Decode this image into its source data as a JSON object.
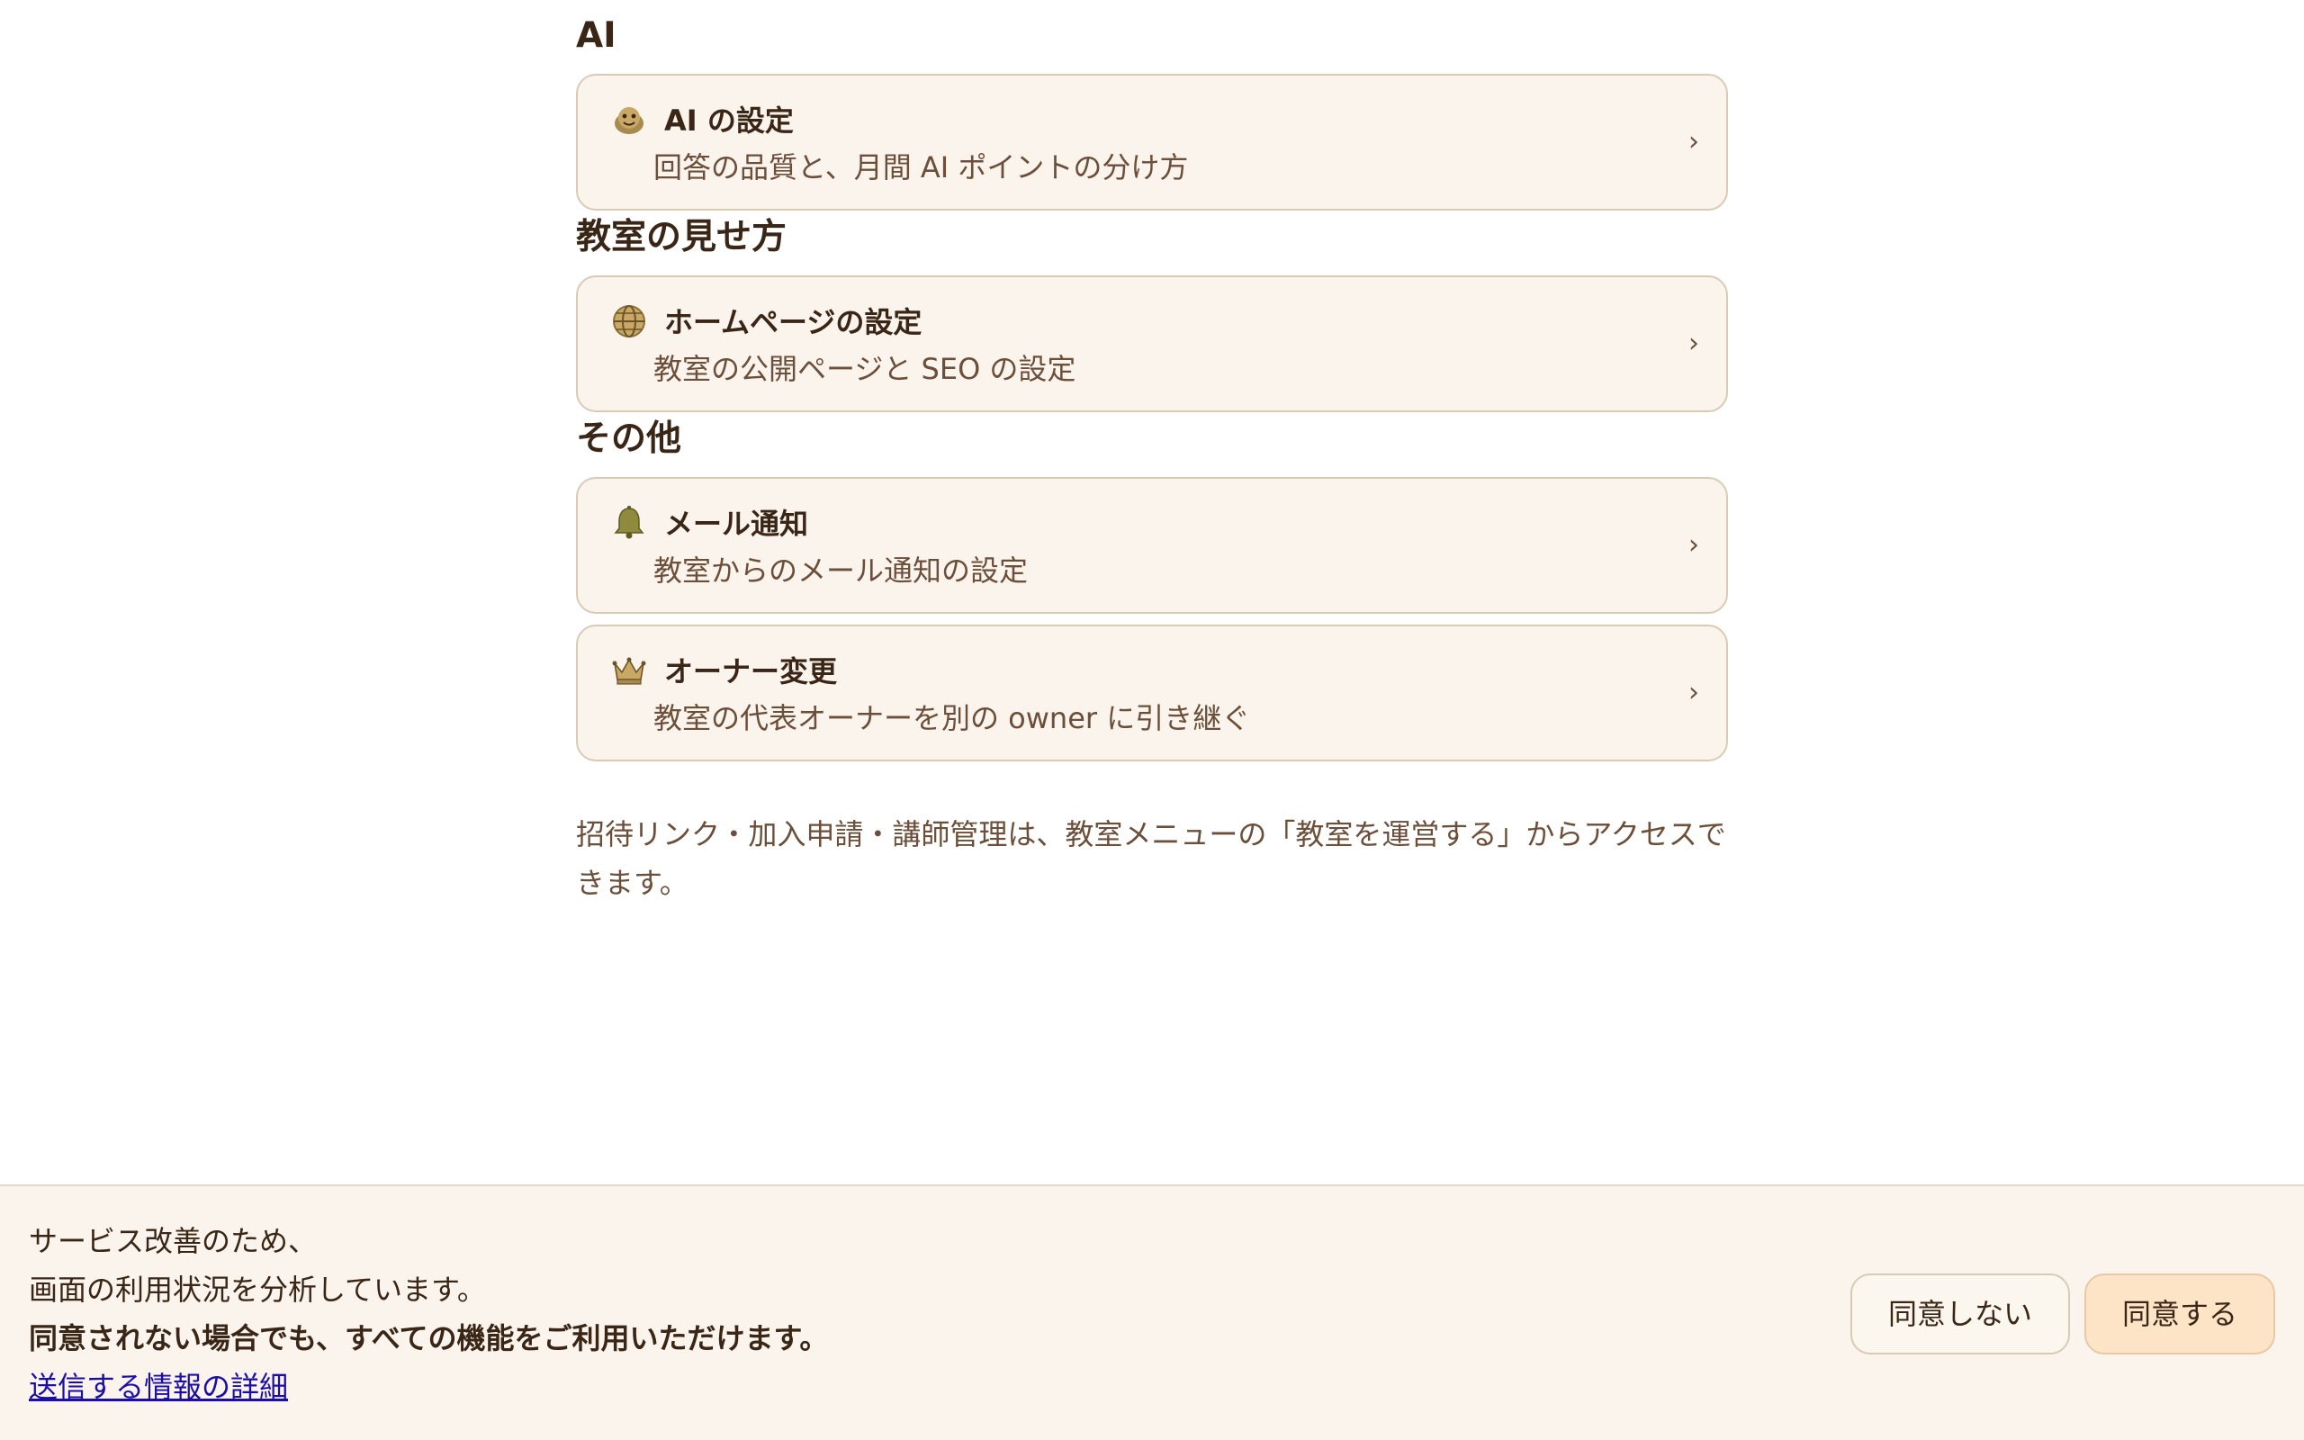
{
  "sections": [
    {
      "title": "AI",
      "items": [
        {
          "icon": "turtle-icon",
          "title": "AI の設定",
          "description": "回答の品質と、月間 AI ポイントの分け方",
          "chevron": "›"
        }
      ]
    },
    {
      "title": "教室の見せ方",
      "items": [
        {
          "icon": "globe-icon",
          "title": "ホームページの設定",
          "description": "教室の公開ページと SEO の設定",
          "chevron": "›"
        }
      ]
    },
    {
      "title": "その他",
      "items": [
        {
          "icon": "bell-icon",
          "title": "メール通知",
          "description": "教室からのメール通知の設定",
          "chevron": "›"
        },
        {
          "icon": "crown-icon",
          "title": "オーナー変更",
          "description": "教室の代表オーナーを別の owner に引き継ぐ",
          "chevron": "›"
        }
      ]
    }
  ],
  "note": {
    "line1": "招待リンク・加入申請・講師管理は、教室メニューの「教室を運営する」からアクセスで",
    "line2": "きます。"
  },
  "consent": {
    "line1": "サービス改善のため、",
    "line2": "画面の利用状況を分析しています。",
    "bold_line": "同意されない場合でも、すべての機能をご利用いただけます。",
    "link": "送信する情報の詳細",
    "decline_label": "同意しない",
    "accept_label": "同意する"
  },
  "colors": {
    "card_bg": "#faf4ec",
    "card_border": "#d9cbb3",
    "accept_bg": "#fde4c7",
    "link": "#1a0dab",
    "text_dark": "#3a2616",
    "text_muted": "#6b4f3a"
  }
}
